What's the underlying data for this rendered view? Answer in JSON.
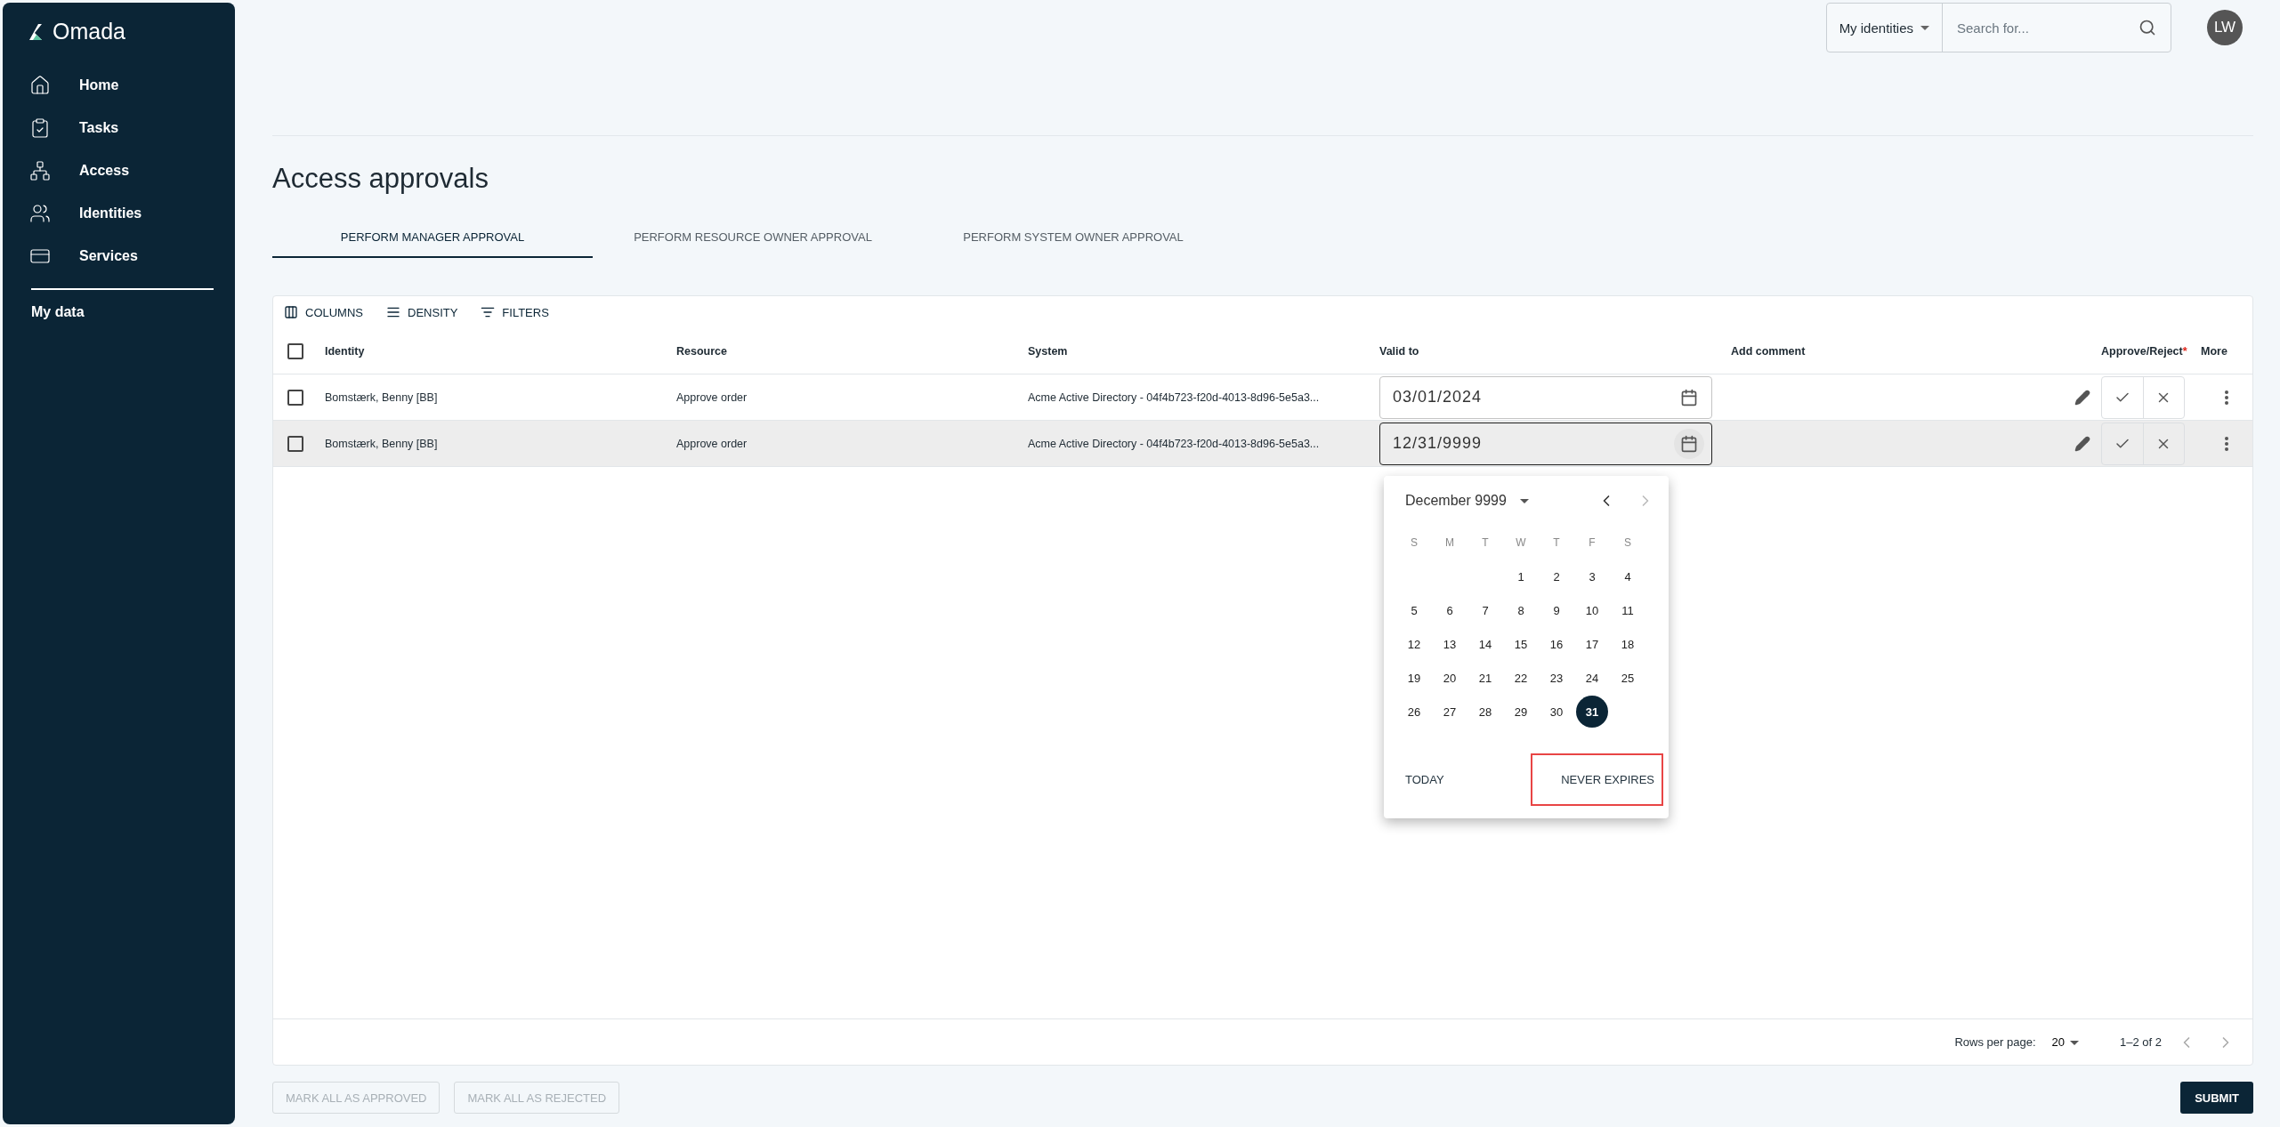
{
  "sidebar": {
    "logo": "Omada",
    "items": [
      {
        "label": "Home",
        "selected": false
      },
      {
        "label": "Tasks",
        "selected": false
      },
      {
        "label": "Access",
        "selected": false
      },
      {
        "label": "Identities",
        "selected": false
      },
      {
        "label": "Services",
        "selected": false
      }
    ],
    "section": "My data"
  },
  "topbar": {
    "scope": "My identities",
    "search": {
      "placeholder": "Search for..."
    },
    "avatar": "LW"
  },
  "page_title": "Access approvals",
  "tabs": [
    {
      "label": "PERFORM MANAGER APPROVAL",
      "selected": true
    },
    {
      "label": "PERFORM RESOURCE OWNER APPROVAL",
      "selected": false
    },
    {
      "label": "PERFORM SYSTEM OWNER APPROVAL",
      "selected": false
    }
  ],
  "toolbar": [
    {
      "label": "COLUMNS",
      "kind": "columns"
    },
    {
      "label": "DENSITY",
      "kind": "density"
    },
    {
      "label": "FILTERS",
      "kind": "filters"
    }
  ],
  "table": {
    "select_all_checked": false,
    "columns": [
      {
        "label": "Identity"
      },
      {
        "label": "Resource"
      },
      {
        "label": "System"
      },
      {
        "label": "Valid to"
      },
      {
        "label": "Add comment"
      },
      {
        "label": "Approve/Reject",
        "required_mark": "*"
      },
      {
        "label": "More"
      }
    ],
    "rows": [
      {
        "checked": false,
        "highlighted": false,
        "identity": "Bomstærk, Benny [BB]",
        "resource": "Approve order",
        "system": "Acme Active Directory - 04f4b723-f20d-4013-8d96-5e5a3...",
        "valid_to": "03/01/2024",
        "date_focused": false
      },
      {
        "checked": false,
        "highlighted": true,
        "identity": "Bomstærk, Benny [BB]",
        "resource": "Approve order",
        "system": "Acme Active Directory - 04f4b723-f20d-4013-8d96-5e5a3...",
        "valid_to": "12/31/9999",
        "date_focused": true
      }
    ],
    "pagination": {
      "rows_per_page_label": "Rows per page:",
      "rows_per_page": "20",
      "range": "1–2 of 2"
    }
  },
  "date_picker": {
    "month": "December 9999",
    "next_disabled": true,
    "weekdays": [
      "S",
      "M",
      "T",
      "W",
      "T",
      "F",
      "S"
    ],
    "weeks": [
      [
        {
          "day": "1",
          "selected": false
        },
        {
          "day": "2",
          "selected": false
        },
        {
          "day": "3",
          "selected": false
        },
        {
          "day": "4",
          "selected": false
        }
      ],
      [
        {
          "day": "5",
          "selected": false
        },
        {
          "day": "6",
          "selected": false
        },
        {
          "day": "7",
          "selected": false
        },
        {
          "day": "8",
          "selected": false
        },
        {
          "day": "9",
          "selected": false
        },
        {
          "day": "10",
          "selected": false
        },
        {
          "day": "11",
          "selected": false
        }
      ],
      [
        {
          "day": "12",
          "selected": false
        },
        {
          "day": "13",
          "selected": false
        },
        {
          "day": "14",
          "selected": false
        },
        {
          "day": "15",
          "selected": false
        },
        {
          "day": "16",
          "selected": false
        },
        {
          "day": "17",
          "selected": false
        },
        {
          "day": "18",
          "selected": false
        }
      ],
      [
        {
          "day": "19",
          "selected": false
        },
        {
          "day": "20",
          "selected": false
        },
        {
          "day": "21",
          "selected": false
        },
        {
          "day": "22",
          "selected": false
        },
        {
          "day": "23",
          "selected": false
        },
        {
          "day": "24",
          "selected": false
        },
        {
          "day": "25",
          "selected": false
        }
      ],
      [
        {
          "day": "26",
          "selected": false
        },
        {
          "day": "27",
          "selected": false
        },
        {
          "day": "28",
          "selected": false
        },
        {
          "day": "29",
          "selected": false
        },
        {
          "day": "30",
          "selected": false
        },
        {
          "day": "31",
          "selected": true
        }
      ]
    ],
    "actions": [
      {
        "label": "TODAY",
        "highlighted": false
      },
      {
        "label": "NEVER EXPIRES",
        "highlighted": true
      }
    ]
  },
  "footer": {
    "buttons": [
      {
        "label": "MARK ALL AS APPROVED",
        "disabled": true
      },
      {
        "label": "MARK ALL AS REJECTED",
        "disabled": true
      }
    ],
    "submit": "SUBMIT"
  }
}
